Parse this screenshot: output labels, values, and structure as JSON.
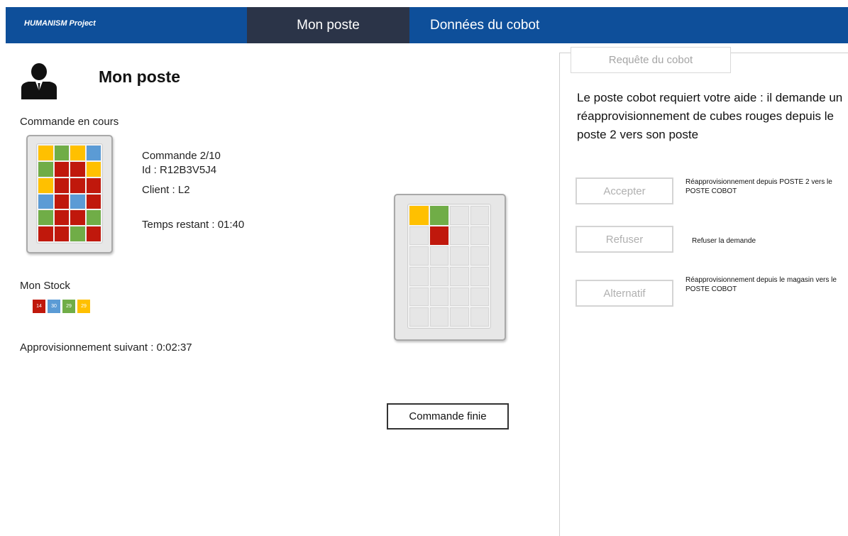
{
  "header": {
    "brand": "HUMANISM Project",
    "tabs": [
      {
        "label": "Mon poste"
      },
      {
        "label": "Données du cobot"
      }
    ]
  },
  "main": {
    "title": "Mon poste",
    "current_order_label": "Commande en cours",
    "order": {
      "number": "Commande 2/10",
      "id": "Id : R12B3V5J4",
      "client": "Client : L2",
      "time_left": "Temps restant : 01:40"
    },
    "stock_label": "Mon Stock",
    "stock": [
      {
        "value": "14",
        "color": "#c0180c"
      },
      {
        "value": "30",
        "color": "#5b9bd5"
      },
      {
        "value": "29",
        "color": "#70ad47"
      },
      {
        "value": "29",
        "color": "#ffc000"
      }
    ],
    "next_supply": "Approvisionnement suivant : 0:02:37",
    "done_button": "Commande finie"
  },
  "order_tray": [
    [
      "yellow",
      "green",
      "yellow",
      "blue"
    ],
    [
      "green",
      "red",
      "red",
      "yellow"
    ],
    [
      "yellow",
      "red",
      "red",
      "red"
    ],
    [
      "blue",
      "red",
      "blue",
      "red"
    ],
    [
      "green",
      "red",
      "red",
      "green"
    ],
    [
      "red",
      "red",
      "green",
      "red"
    ]
  ],
  "work_tray": [
    [
      "yellow",
      "green",
      "empty",
      "empty"
    ],
    [
      "empty",
      "red",
      "empty",
      "empty"
    ],
    [
      "empty",
      "empty",
      "empty",
      "empty"
    ],
    [
      "empty",
      "empty",
      "empty",
      "empty"
    ],
    [
      "empty",
      "empty",
      "empty",
      "empty"
    ],
    [
      "empty",
      "empty",
      "empty",
      "empty"
    ]
  ],
  "colors": {
    "yellow": "#ffc000",
    "green": "#70ad47",
    "blue": "#5b9bd5",
    "red": "#c0180c",
    "empty": "#e6e6e6",
    "header": "#0e4f9a",
    "active_tab": "#2b3448"
  },
  "request_panel": {
    "tab_label": "Requête du cobot",
    "message": "Le poste cobot requiert votre aide : il demande un réapprovisionnement de cubes rouges depuis le poste 2 vers son poste",
    "options": [
      {
        "button": "Accepter",
        "description": "Réapprovisionnement depuis POSTE 2 vers le POSTE COBOT"
      },
      {
        "button": "Refuser",
        "description": "Refuser la demande"
      },
      {
        "button": "Alternatif",
        "description": "Réapprovisionnement depuis le magasin vers le POSTE COBOT"
      }
    ]
  }
}
